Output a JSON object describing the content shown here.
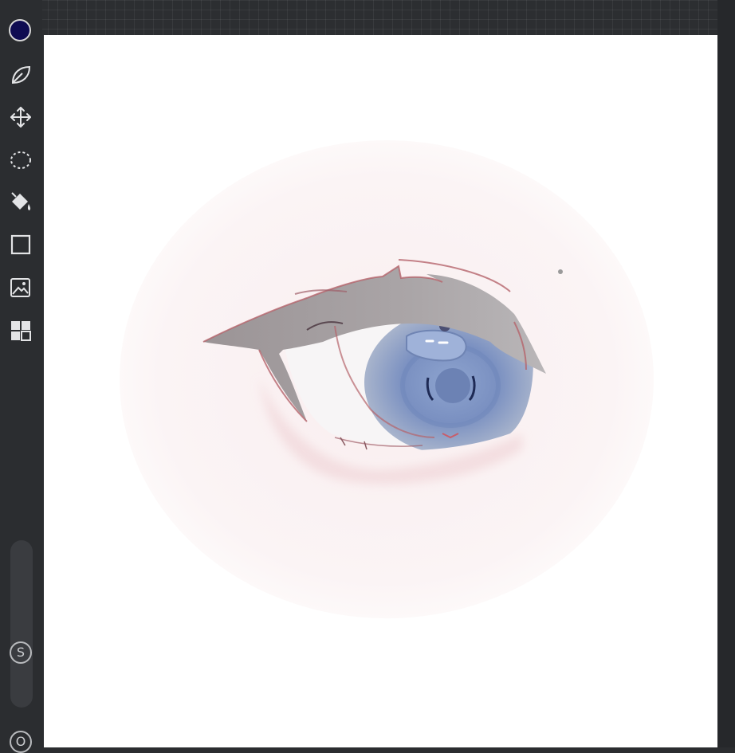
{
  "app": {
    "colors": {
      "active_color": "#0f0c52",
      "sidebar_bg": "#2b2d30",
      "canvas_bg": "#ffffff",
      "skin_tint": "#fbf3f4",
      "iris_blue": "#7d93c2",
      "lid_gray": "#a7a3a5",
      "line_red": "#b5646b"
    }
  },
  "toolbar": {
    "tools": [
      {
        "id": "color",
        "icon": "color-swatch-icon"
      },
      {
        "id": "brush",
        "icon": "brush-leaf-icon"
      },
      {
        "id": "transform",
        "icon": "move-arrows-icon"
      },
      {
        "id": "selection",
        "icon": "lasso-selection-icon"
      },
      {
        "id": "fill",
        "icon": "paint-bucket-icon"
      },
      {
        "id": "shape",
        "icon": "square-shape-icon"
      },
      {
        "id": "image",
        "icon": "image-transform-icon"
      },
      {
        "id": "layers",
        "icon": "layers-grid-icon"
      }
    ],
    "brush_size_label": "S",
    "opacity_label": "O"
  }
}
